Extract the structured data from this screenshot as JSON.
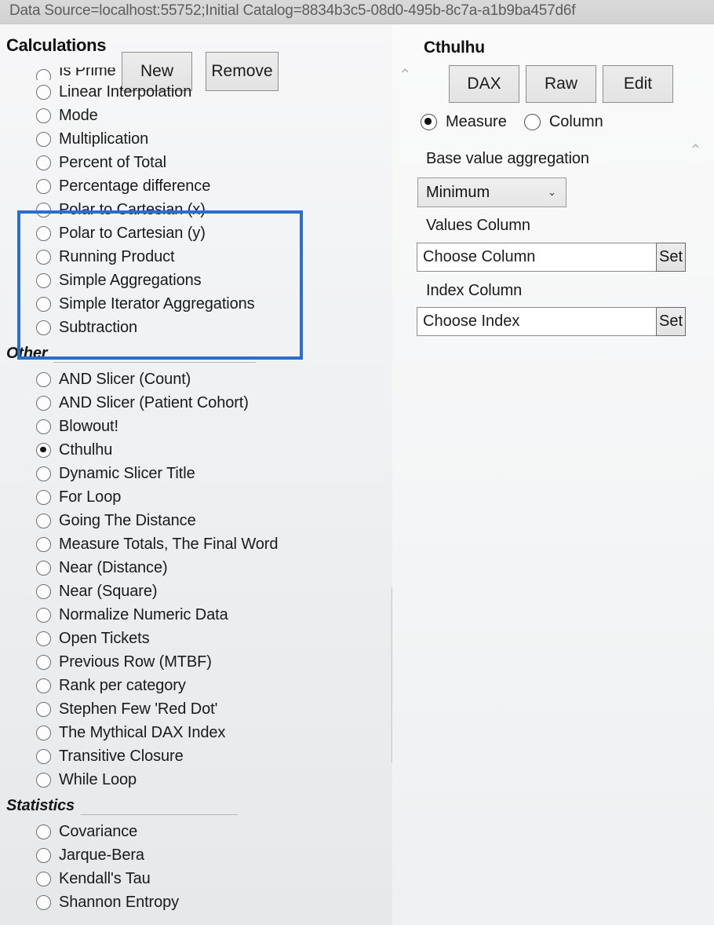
{
  "titlebar": {
    "connection_string": "Data Source=localhost:55752;Initial Catalog=8834b3c5-08d0-495b-8c7a-a1b9ba457d6f"
  },
  "left_panel": {
    "header_title": "Calculations",
    "new_button": "New",
    "remove_button": "Remove",
    "selected_item": "Cthulhu",
    "items_top": [
      {
        "label": "Is Prime",
        "checked": false,
        "clipped": true
      },
      {
        "label": "Linear Interpolation",
        "checked": false
      },
      {
        "label": "Mode",
        "checked": false
      },
      {
        "label": "Multiplication",
        "checked": false
      },
      {
        "label": "Percent of Total",
        "checked": false
      },
      {
        "label": "Percentage difference",
        "checked": false
      },
      {
        "label": "Polar to Cartesian (x)",
        "checked": false
      },
      {
        "label": "Polar to Cartesian (y)",
        "checked": false
      },
      {
        "label": "Running Product",
        "checked": false
      },
      {
        "label": "Simple Aggregations",
        "checked": false
      },
      {
        "label": "Simple Iterator Aggregations",
        "checked": false
      },
      {
        "label": "Subtraction",
        "checked": false
      }
    ],
    "sections": [
      {
        "title": "Other",
        "items": [
          {
            "label": "AND Slicer (Count)",
            "checked": false
          },
          {
            "label": "AND Slicer (Patient Cohort)",
            "checked": false
          },
          {
            "label": "Blowout!",
            "checked": false
          },
          {
            "label": "Cthulhu",
            "checked": true
          },
          {
            "label": "Dynamic Slicer Title",
            "checked": false
          },
          {
            "label": "For Loop",
            "checked": false
          },
          {
            "label": "Going The Distance",
            "checked": false
          },
          {
            "label": "Measure Totals, The Final Word",
            "checked": false
          },
          {
            "label": "Near (Distance)",
            "checked": false
          },
          {
            "label": "Near (Square)",
            "checked": false
          },
          {
            "label": "Normalize Numeric Data",
            "checked": false
          },
          {
            "label": "Open Tickets",
            "checked": false
          },
          {
            "label": "Previous Row (MTBF)",
            "checked": false
          },
          {
            "label": "Rank per category",
            "checked": false
          },
          {
            "label": "Stephen Few 'Red Dot'",
            "checked": false
          },
          {
            "label": "The Mythical DAX Index",
            "checked": false
          },
          {
            "label": "Transitive Closure",
            "checked": false
          },
          {
            "label": "While Loop",
            "checked": false
          }
        ]
      },
      {
        "title": "Statistics",
        "items": [
          {
            "label": "Covariance",
            "checked": false
          },
          {
            "label": "Jarque-Bera",
            "checked": false
          },
          {
            "label": "Kendall's Tau",
            "checked": false
          },
          {
            "label": "Shannon Entropy",
            "checked": false
          }
        ]
      }
    ],
    "highlight_color": "#2a6fc9"
  },
  "right_panel": {
    "title": "Cthulhu",
    "buttons": {
      "dax": "DAX",
      "raw": "Raw",
      "edit": "Edit"
    },
    "mode": {
      "measure_label": "Measure",
      "column_label": "Column",
      "selected": "Measure"
    },
    "base_value_aggregation": {
      "label": "Base value aggregation",
      "selected": "Minimum",
      "chevron": "⌄"
    },
    "values_column": {
      "label": "Values Column",
      "value": "Choose Column",
      "set_button": "Set"
    },
    "index_column": {
      "label": "Index Column",
      "value": "Choose Index",
      "set_button": "Set"
    },
    "collapse_chevron": "⌃"
  }
}
